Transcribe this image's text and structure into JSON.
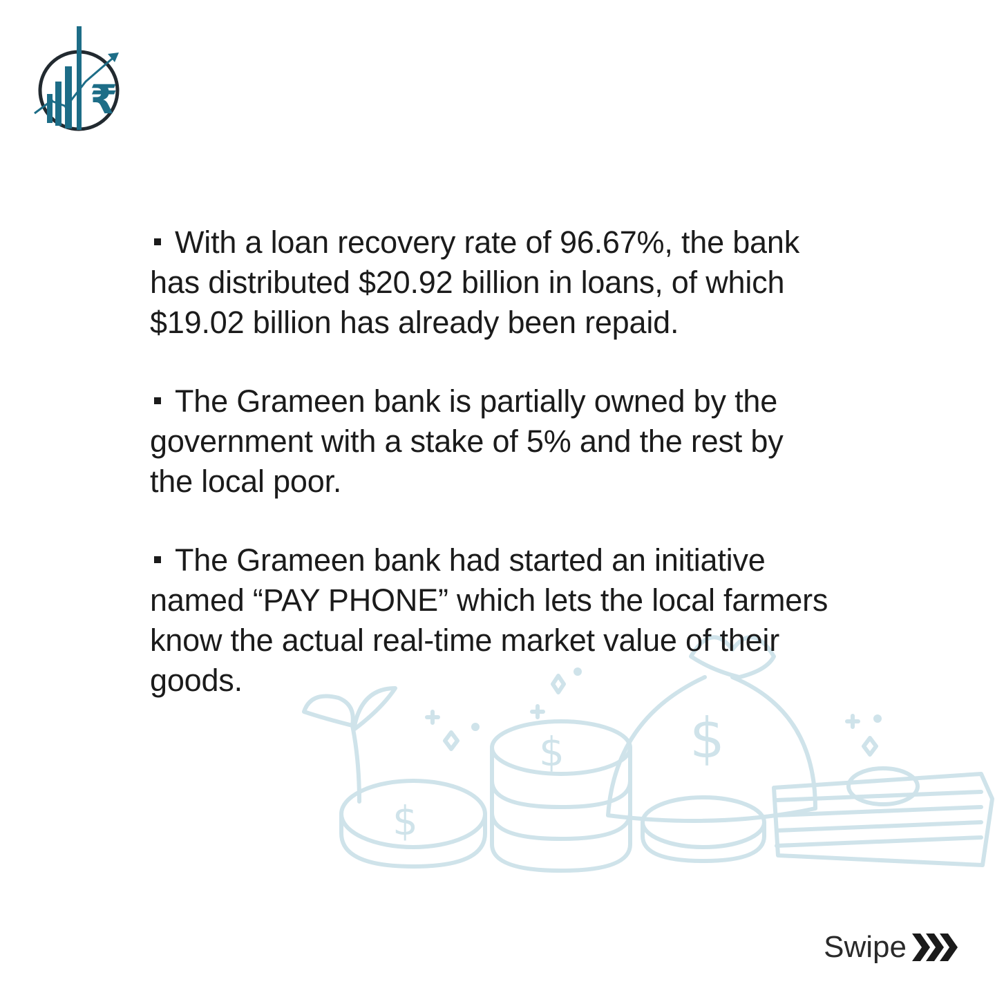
{
  "brand": {
    "logo_icon": "rupee-growth-chart-logo",
    "logo_symbol": "₹",
    "colors": {
      "teal": "#1d6d87",
      "dark": "#222a30",
      "illustration": "#cfe3ea"
    }
  },
  "bullets": [
    "With a loan recovery rate of 96.67%, the bank has distributed $20.92 billion in loans, of which $19.02 billion has already been repaid.",
    "The Grameen bank is partially owned by the government with a stake of 5% and the rest by the local poor.",
    "The Grameen bank had started an initiative named “PAY PHONE” which lets the local farmers know the actual real-time market value of their goods."
  ],
  "illustration": {
    "icon": "money-bag-coins-cash-illustration",
    "symbol": "$"
  },
  "swipe": {
    "label": "Swipe",
    "icon": "triple-chevron-right-icon"
  }
}
